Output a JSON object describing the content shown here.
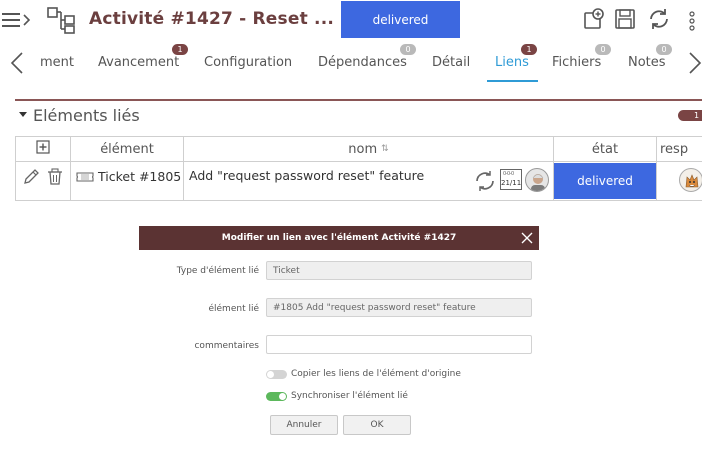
{
  "header": {
    "title": "Activité  #1427  - Reset ...",
    "status": "delivered"
  },
  "tabs": [
    {
      "label": "ment",
      "badge": ""
    },
    {
      "label": "Avancement",
      "badge": "1"
    },
    {
      "label": "Configuration",
      "badge": ""
    },
    {
      "label": "Dépendances",
      "badge": "0"
    },
    {
      "label": "Détail",
      "badge": ""
    },
    {
      "label": "Liens",
      "badge": "1",
      "active": true
    },
    {
      "label": "Fichiers",
      "badge": "0"
    },
    {
      "label": "Notes",
      "badge": "0"
    }
  ],
  "section": {
    "title": "Eléments liés",
    "count": "1"
  },
  "table": {
    "headers": {
      "element": "élément",
      "nom": "nom",
      "sort_icon": "⇅",
      "etat": "état",
      "resp": "resp"
    },
    "row": {
      "element": "Ticket #1805",
      "nom": "Add \"request password reset\" feature",
      "date": "21/11",
      "etat": "delivered"
    }
  },
  "dialog": {
    "title": "Modifier un lien avec l'élément Activité #1427",
    "fields": {
      "type_label": "Type d'élément lié",
      "type_value": "Ticket",
      "element_label": "élément lié",
      "element_value": "#1805 Add \"request password reset\" feature",
      "comment_label": "commentaires",
      "comment_value": ""
    },
    "toggles": {
      "copy_label": "Copier les liens de l'élément d'origine",
      "copy_on": false,
      "sync_label": "Synchroniser l'élément lié",
      "sync_on": true
    },
    "buttons": {
      "cancel": "Annuler",
      "ok": "OK"
    }
  },
  "colors": {
    "brand": "#6b3f3f",
    "status_blue": "#3d68e0",
    "tab_active": "#2f9bd6",
    "badge_dark": "#7a4444",
    "toggle_on": "#5cb85c",
    "dialog_header": "#5b3333"
  },
  "icons": [
    "hamburger-icon",
    "chevron-right-icon",
    "org-chart-icon",
    "add-window-icon",
    "save-icon",
    "refresh-icon",
    "more-vertical-icon",
    "chevron-left-icon",
    "plus-icon",
    "pencil-icon",
    "trash-icon",
    "ticket-icon",
    "sync-icon",
    "calendar-icon",
    "avatar",
    "close-icon"
  ]
}
